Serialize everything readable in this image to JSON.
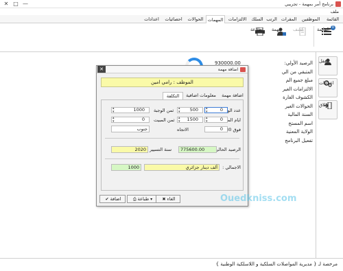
{
  "window": {
    "title": "برنامج أمر بمهمة - تجريبي",
    "controls": {
      "minimize": "—",
      "maximize": "□",
      "close": "✕"
    }
  },
  "menu": {
    "label": "ملف"
  },
  "tabs": [
    "القائمة",
    "الموظفين",
    "المقرات",
    "الرتب",
    "السلك",
    "الالتزامات",
    "المهمات",
    "الحوالات",
    "احصائيات",
    "اعدادات"
  ],
  "active_tab": "المهمات",
  "ribbon": {
    "list_label": "القائمة",
    "list_badge": "0",
    "hide_label": "كشف",
    "task_label": "مهمة",
    "print_label": "طباعة"
  },
  "sidebar": {
    "lock_label": "قفل",
    "settings_label": "اعدادات",
    "close_label": "اغلاق"
  },
  "background_list": {
    "items": [
      "الرصيد الأولي:",
      "المتبقي من الي",
      "مبلغ جميع الم",
      "الالتزامات الغير",
      "الكشوف الغارة",
      "الحوالات الغير",
      "السنة المالية",
      "اسم المستخ",
      "الولاية المعنية",
      "تفعيل البرنامج"
    ],
    "first_value": "930000.00"
  },
  "status": {
    "text": "مرخصة لـ { مديرية المواصلات السلكية و اللاسلكية الوطنية }"
  },
  "dialog": {
    "title": "اضافة مهمة",
    "close": "✕",
    "employee": "الموظف : رامي امين",
    "tabs": [
      "اضافة مهمة",
      "معلومات اضافية",
      "التكلفة"
    ],
    "active_tab": "التكلفة",
    "meals_label": "عدد الوجبات",
    "meals_value": "0",
    "meal_price_value": "500",
    "meal_cost_label": "ثمن الوجبة",
    "meal_cost_value": "1000",
    "nights_label": "ايام المبيت",
    "nights_value": "0",
    "night_price_value": "1500",
    "night_cost_label": "ثمن المبيت",
    "night_cost_value": "0",
    "over30_label": "فوق 30 يوم",
    "over30_value": "0",
    "direction_label": "الاتجاه",
    "direction_value": "جنوب",
    "balance_label": "الرصيد الحالي",
    "balance_value": "775600.00",
    "year_label": "سنة التسيير",
    "year_value": "2020",
    "total_label": "الاجمالي :",
    "total_words": "ألف دينار جزائري",
    "total_value": "1000",
    "add_button": "اضافة",
    "print_button": "طباعة",
    "cancel_button": "الغاء",
    "watermark": "Ouedkniss.com"
  },
  "colors": {
    "accent": "#2d6fb8",
    "employee_bg": "#fafaa8",
    "balance_bg": "#d6f7c4",
    "year_bg": "#fafaa8",
    "total_words_bg": "#fafaa8",
    "total_value_bg": "#d6f7c4"
  }
}
